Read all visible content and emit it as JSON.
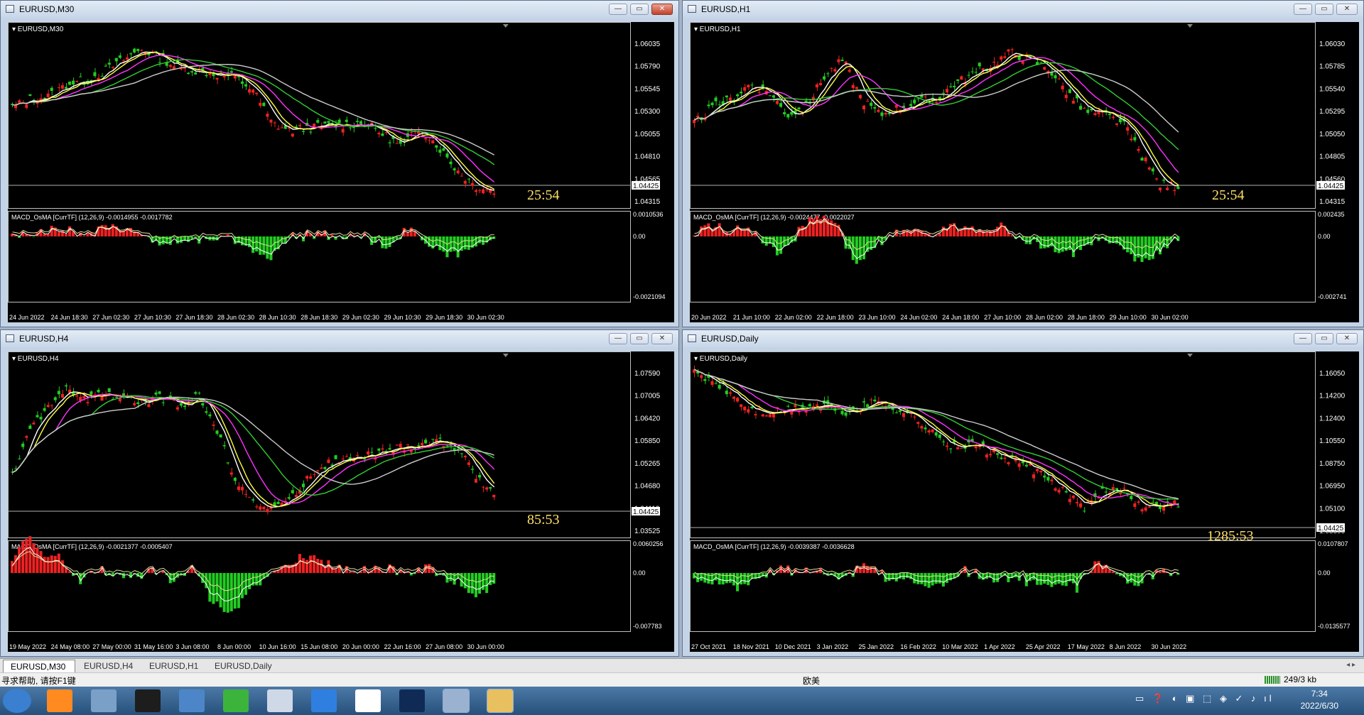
{
  "charts": [
    {
      "title": "EURUSD,M30",
      "label": "EURUSD,M30",
      "countdown": "25:54",
      "price_ticks": [
        "1.06035",
        "1.05790",
        "1.05545",
        "1.05300",
        "1.05055",
        "1.04810",
        "1.04565",
        "1.04315"
      ],
      "current_price": "1.04425",
      "macd_title": "MACD_OsMA [CurrTF] (12,26,9) -0.0014955 -0.0017782",
      "macd_ticks": [
        "0.0010536",
        "0.00",
        "-0.0021094"
      ],
      "time_ticks": [
        "24 Jun 2022",
        "24 Jun 18:30",
        "27 Jun 02:30",
        "27 Jun 10:30",
        "27 Jun 18:30",
        "28 Jun 02:30",
        "28 Jun 10:30",
        "28 Jun 18:30",
        "29 Jun 02:30",
        "29 Jun 10:30",
        "29 Jun 18:30",
        "30 Jun 02:30"
      ]
    },
    {
      "title": "EURUSD,H1",
      "label": "EURUSD,H1",
      "countdown": "25:54",
      "price_ticks": [
        "1.06030",
        "1.05785",
        "1.05540",
        "1.05295",
        "1.05050",
        "1.04805",
        "1.04560",
        "1.04315"
      ],
      "current_price": "1.04425",
      "macd_title": "MACD_OsMA [CurrTF] (12,26,9) -0.0024477 -0.0022027",
      "macd_ticks": [
        "0.002435",
        "0.00",
        "-0.002741"
      ],
      "time_ticks": [
        "20 Jun 2022",
        "21 Jun 10:00",
        "22 Jun 02:00",
        "22 Jun 18:00",
        "23 Jun 10:00",
        "24 Jun 02:00",
        "24 Jun 18:00",
        "27 Jun 10:00",
        "28 Jun 02:00",
        "28 Jun 18:00",
        "29 Jun 10:00",
        "30 Jun 02:00"
      ]
    },
    {
      "title": "EURUSD,H4",
      "label": "EURUSD,H4",
      "countdown": "85:53",
      "price_ticks": [
        "1.07590",
        "1.07005",
        "1.06420",
        "1.05850",
        "1.05265",
        "1.04680",
        "1.04110",
        "1.03525"
      ],
      "current_price": "1.04425",
      "macd_title": "MACD_OsMA [CurrTF] (12,26,9) -0.0021377 -0.0005407",
      "macd_ticks": [
        "0.0060256",
        "0.00",
        "-0.007783"
      ],
      "time_ticks": [
        "19 May 2022",
        "24 May 08:00",
        "27 May 00:00",
        "31 May 16:00",
        "3 Jun 08:00",
        "8 Jun 00:00",
        "10 Jun 16:00",
        "15 Jun 08:00",
        "20 Jun 00:00",
        "22 Jun 16:00",
        "27 Jun 08:00",
        "30 Jun 00:00"
      ]
    },
    {
      "title": "EURUSD,Daily",
      "label": "EURUSD,Daily",
      "countdown": "1285:53",
      "price_ticks": [
        "1.16050",
        "1.14200",
        "1.12400",
        "1.10550",
        "1.08750",
        "1.06950",
        "1.05100",
        "1.03300"
      ],
      "current_price": "1.04425",
      "macd_title": "MACD_OsMA [CurrTF] (12,26,9) -0.0039387 -0.0036628",
      "macd_ticks": [
        "0.0107807",
        "0.00",
        "-0.0135577"
      ],
      "time_ticks": [
        "27 Oct 2021",
        "18 Nov 2021",
        "10 Dec 2021",
        "3 Jan 2022",
        "25 Jan 2022",
        "16 Feb 2022",
        "10 Mar 2022",
        "1 Apr 2022",
        "25 Apr 2022",
        "17 May 2022",
        "8 Jun 2022",
        "30 Jun 2022"
      ]
    }
  ],
  "colors": {
    "bull": "#22cc22",
    "bear": "#ee2222",
    "ma1": "#ffffff",
    "ma2": "#ffff44",
    "ma3": "#ff33ff",
    "ma4": "#33cc33",
    "ma5": "#cccccc",
    "countdown": "#ffe066"
  },
  "tabs": [
    "EURUSD,M30",
    "EURUSD,H4",
    "EURUSD,H1",
    "EURUSD,Daily"
  ],
  "status": {
    "help": "寻求帮助, 请按F1键",
    "market": "欧美",
    "traffic": "249/3 kb"
  },
  "clock": {
    "time": "7:34",
    "date": "2022/6/30"
  },
  "taskbar_icons": [
    "start-orb",
    "firefox-icon",
    "network-icon",
    "terminal-icon",
    "desktop-icon",
    "wechat-icon",
    "notes-icon",
    "pen-icon",
    "qq-icon",
    "photoshop-icon",
    "image-viewer-icon",
    "metatrader-icon"
  ]
}
